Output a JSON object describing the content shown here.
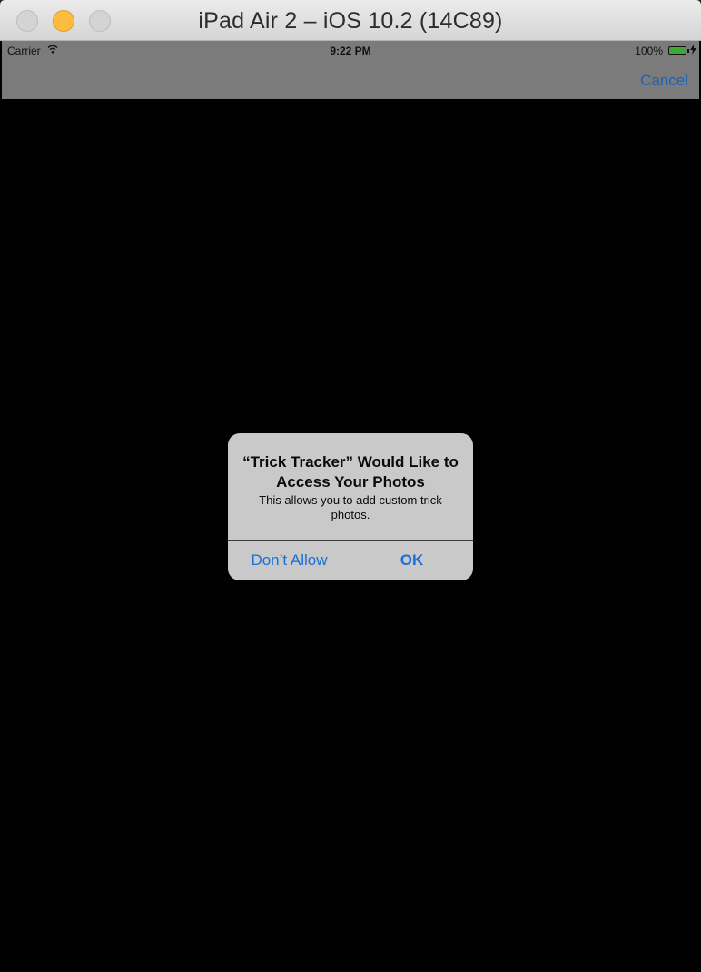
{
  "window": {
    "title": "iPad Air 2 – iOS 10.2 (14C89)"
  },
  "status_bar": {
    "carrier": "Carrier",
    "time": "9:22 PM",
    "battery_percent": "100%"
  },
  "nav_bar": {
    "cancel_label": "Cancel"
  },
  "alert": {
    "title": "“Trick Tracker” Would Like to Access Your Photos",
    "message": "This allows you to add custom trick photos.",
    "buttons": {
      "dont_allow": "Don’t Allow",
      "ok": "OK"
    }
  },
  "colors": {
    "accent": "#1a6fd6",
    "battery": "#3da935",
    "minimize": "#fdbc40"
  }
}
